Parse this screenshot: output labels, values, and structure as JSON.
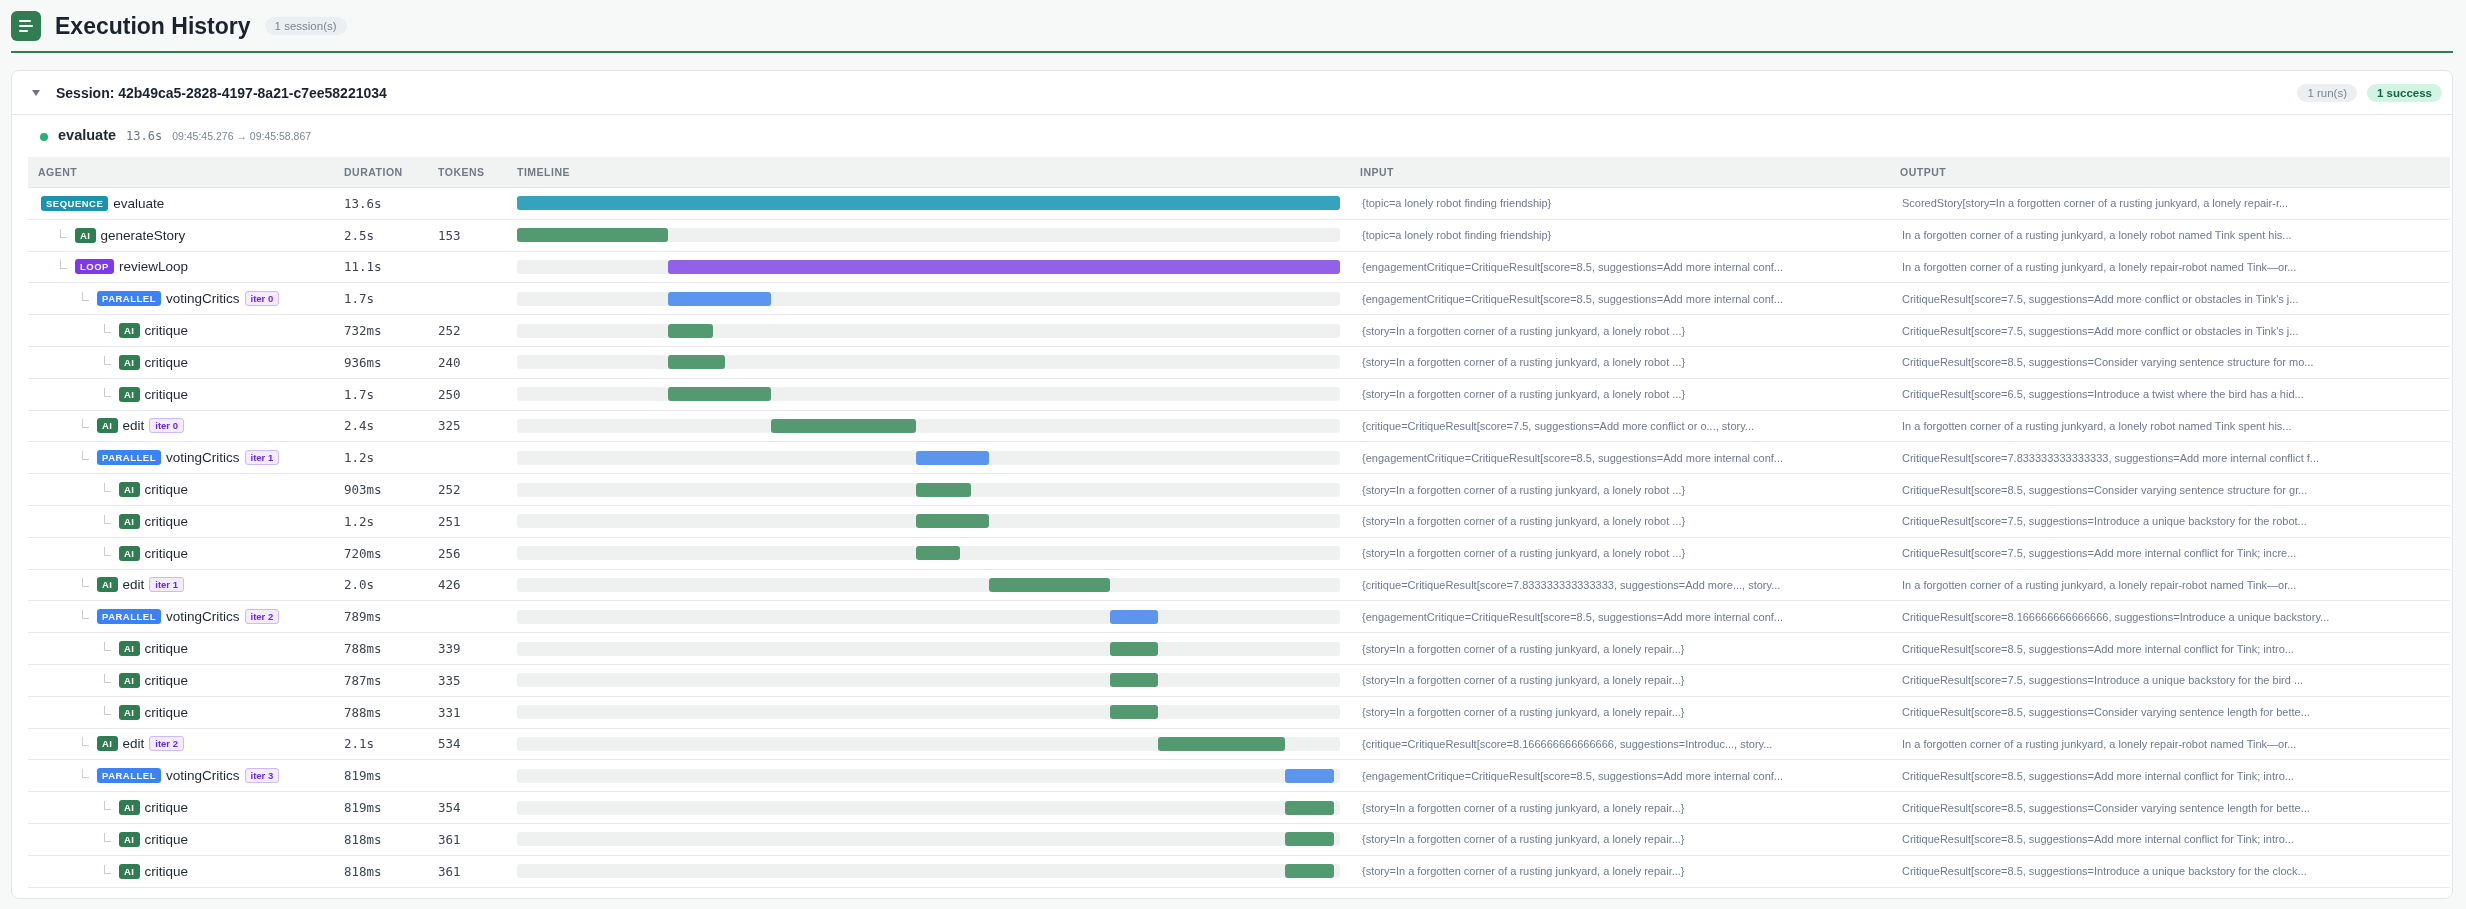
{
  "header": {
    "title": "Execution History",
    "count": "1 session(s)"
  },
  "session": {
    "title": "Session: 42b49ca5-2828-4197-8a21-c7ee58221034",
    "expanded": true,
    "runs": "1 run(s)",
    "success": "1 success",
    "run": {
      "succeeded": true,
      "name": "evaluate",
      "duration": "13.6s",
      "time_range": "09:45:45.276 → 09:45:58.867",
      "table": {
        "columns": [
          "AGENT",
          "DURATION",
          "TOKENS",
          "TIMELINE",
          "INPUT",
          "OUTPUT"
        ],
        "rows": [
          {
            "kind": "sequence",
            "badge": "SEQUENCE",
            "name": "evaluate",
            "duration": "13.6s",
            "input": "{topic=a lonely robot finding friendship}",
            "output": "ScoredStory[story=In a forgotten corner of a rusting junkyard, a lonely repair-r...",
            "children": [
              {
                "kind": "ai",
                "badge": "AI",
                "name": "generateStory",
                "duration": "2.5s",
                "tokens": "153",
                "input": "{topic=a lonely robot finding friendship}",
                "output": "In a forgotten corner of a rusting junkyard, a lonely robot named Tink spent his..."
              },
              {
                "kind": "loop",
                "badge": "LOOP",
                "name": "reviewLoop",
                "duration": "11.1s",
                "input": "{engagementCritique=CritiqueResult[score=8.5, suggestions=Add more internal conf...",
                "output": "In a forgotten corner of a rusting junkyard, a lonely repair-robot named Tink—or...",
                "children": [
                  {
                    "kind": "parallel",
                    "badge": "PARALLEL",
                    "name": "votingCritics",
                    "iteration": "iter 0",
                    "duration": "1.7s",
                    "input": "{engagementCritique=CritiqueResult[score=8.5, suggestions=Add more internal conf...",
                    "output": "CritiqueResult[score=7.5, suggestions=Add more conflict or obstacles in Tink's j...",
                    "children": [
                      {
                        "kind": "ai",
                        "badge": "AI",
                        "name": "critique",
                        "duration": "732ms",
                        "tokens": "252",
                        "input": "{story=In a forgotten corner of a rusting junkyard, a lonely robot ...}",
                        "output": "CritiqueResult[score=7.5, suggestions=Add more conflict or obstacles in Tink's j..."
                      },
                      {
                        "kind": "ai",
                        "badge": "AI",
                        "name": "critique",
                        "duration": "936ms",
                        "tokens": "240",
                        "input": "{story=In a forgotten corner of a rusting junkyard, a lonely robot ...}",
                        "output": "CritiqueResult[score=8.5, suggestions=Consider varying sentence structure for mo..."
                      },
                      {
                        "kind": "ai",
                        "badge": "AI",
                        "name": "critique",
                        "duration": "1.7s",
                        "tokens": "250",
                        "input": "{story=In a forgotten corner of a rusting junkyard, a lonely robot ...}",
                        "output": "CritiqueResult[score=6.5, suggestions=Introduce a twist where the bird has a hid..."
                      }
                    ]
                  },
                  {
                    "kind": "ai",
                    "badge": "AI",
                    "name": "edit",
                    "iteration": "iter 0",
                    "duration": "2.4s",
                    "tokens": "325",
                    "input": "{critique=CritiqueResult[score=7.5, suggestions=Add more conflict or o..., story...",
                    "output": "In a forgotten corner of a rusting junkyard, a lonely robot named Tink spent his..."
                  },
                  {
                    "kind": "parallel",
                    "badge": "PARALLEL",
                    "name": "votingCritics",
                    "iteration": "iter 1",
                    "duration": "1.2s",
                    "input": "{engagementCritique=CritiqueResult[score=8.5, suggestions=Add more internal conf...",
                    "output": "CritiqueResult[score=7.833333333333333, suggestions=Add more internal conflict f...",
                    "children": [
                      {
                        "kind": "ai",
                        "badge": "AI",
                        "name": "critique",
                        "duration": "903ms",
                        "tokens": "252",
                        "input": "{story=In a forgotten corner of a rusting junkyard, a lonely robot ...}",
                        "output": "CritiqueResult[score=8.5, suggestions=Consider varying sentence structure for gr..."
                      },
                      {
                        "kind": "ai",
                        "badge": "AI",
                        "name": "critique",
                        "duration": "1.2s",
                        "tokens": "251",
                        "input": "{story=In a forgotten corner of a rusting junkyard, a lonely robot ...}",
                        "output": "CritiqueResult[score=7.5, suggestions=Introduce a unique backstory for the robot..."
                      },
                      {
                        "kind": "ai",
                        "badge": "AI",
                        "name": "critique",
                        "duration": "720ms",
                        "tokens": "256",
                        "input": "{story=In a forgotten corner of a rusting junkyard, a lonely robot ...}",
                        "output": "CritiqueResult[score=7.5, suggestions=Add more internal conflict for Tink; incre..."
                      }
                    ]
                  },
                  {
                    "kind": "ai",
                    "badge": "AI",
                    "name": "edit",
                    "iteration": "iter 1",
                    "duration": "2.0s",
                    "tokens": "426",
                    "input": "{critique=CritiqueResult[score=7.833333333333333, suggestions=Add more..., story...",
                    "output": "In a forgotten corner of a rusting junkyard, a lonely repair-robot named Tink—or..."
                  },
                  {
                    "kind": "parallel",
                    "badge": "PARALLEL",
                    "name": "votingCritics",
                    "iteration": "iter 2",
                    "duration": "789ms",
                    "input": "{engagementCritique=CritiqueResult[score=8.5, suggestions=Add more internal conf...",
                    "output": "CritiqueResult[score=8.166666666666666, suggestions=Introduce a unique backstory...",
                    "children": [
                      {
                        "kind": "ai",
                        "badge": "AI",
                        "name": "critique",
                        "duration": "788ms",
                        "tokens": "339",
                        "input": "{story=In a forgotten corner of a rusting junkyard, a lonely repair...}",
                        "output": "CritiqueResult[score=8.5, suggestions=Add more internal conflict for Tink; intro..."
                      },
                      {
                        "kind": "ai",
                        "badge": "AI",
                        "name": "critique",
                        "duration": "787ms",
                        "tokens": "335",
                        "input": "{story=In a forgotten corner of a rusting junkyard, a lonely repair...}",
                        "output": "CritiqueResult[score=7.5, suggestions=Introduce a unique backstory for the bird ..."
                      },
                      {
                        "kind": "ai",
                        "badge": "AI",
                        "name": "critique",
                        "duration": "788ms",
                        "tokens": "331",
                        "input": "{story=In a forgotten corner of a rusting junkyard, a lonely repair...}",
                        "output": "CritiqueResult[score=8.5, suggestions=Consider varying sentence length for bette..."
                      }
                    ]
                  },
                  {
                    "kind": "ai",
                    "badge": "AI",
                    "name": "edit",
                    "iteration": "iter 2",
                    "duration": "2.1s",
                    "tokens": "534",
                    "input": "{critique=CritiqueResult[score=8.166666666666666, suggestions=Introduc..., story...",
                    "output": "In a forgotten corner of a rusting junkyard, a lonely repair-robot named Tink—or..."
                  },
                  {
                    "kind": "parallel",
                    "badge": "PARALLEL",
                    "name": "votingCritics",
                    "iteration": "iter 3",
                    "duration": "819ms",
                    "input": "{engagementCritique=CritiqueResult[score=8.5, suggestions=Add more internal conf...",
                    "output": "CritiqueResult[score=8.5, suggestions=Add more internal conflict for Tink; intro...",
                    "children": [
                      {
                        "kind": "ai",
                        "badge": "AI",
                        "name": "critique",
                        "duration": "819ms",
                        "tokens": "354",
                        "input": "{story=In a forgotten corner of a rusting junkyard, a lonely repair...}",
                        "output": "CritiqueResult[score=8.5, suggestions=Consider varying sentence length for bette..."
                      },
                      {
                        "kind": "ai",
                        "badge": "AI",
                        "name": "critique",
                        "duration": "818ms",
                        "tokens": "361",
                        "input": "{story=In a forgotten corner of a rusting junkyard, a lonely repair...}",
                        "output": "CritiqueResult[score=8.5, suggestions=Add more internal conflict for Tink; intro..."
                      },
                      {
                        "kind": "ai",
                        "badge": "AI",
                        "name": "critique",
                        "duration": "818ms",
                        "tokens": "361",
                        "input": "{story=In a forgotten corner of a rusting junkyard, a lonely repair...}",
                        "output": "CritiqueResult[score=8.5, suggestions=Introduce a unique backstory for the clock..."
                      }
                    ]
                  }
                ]
              }
            ]
          }
        ]
      }
    }
  }
}
